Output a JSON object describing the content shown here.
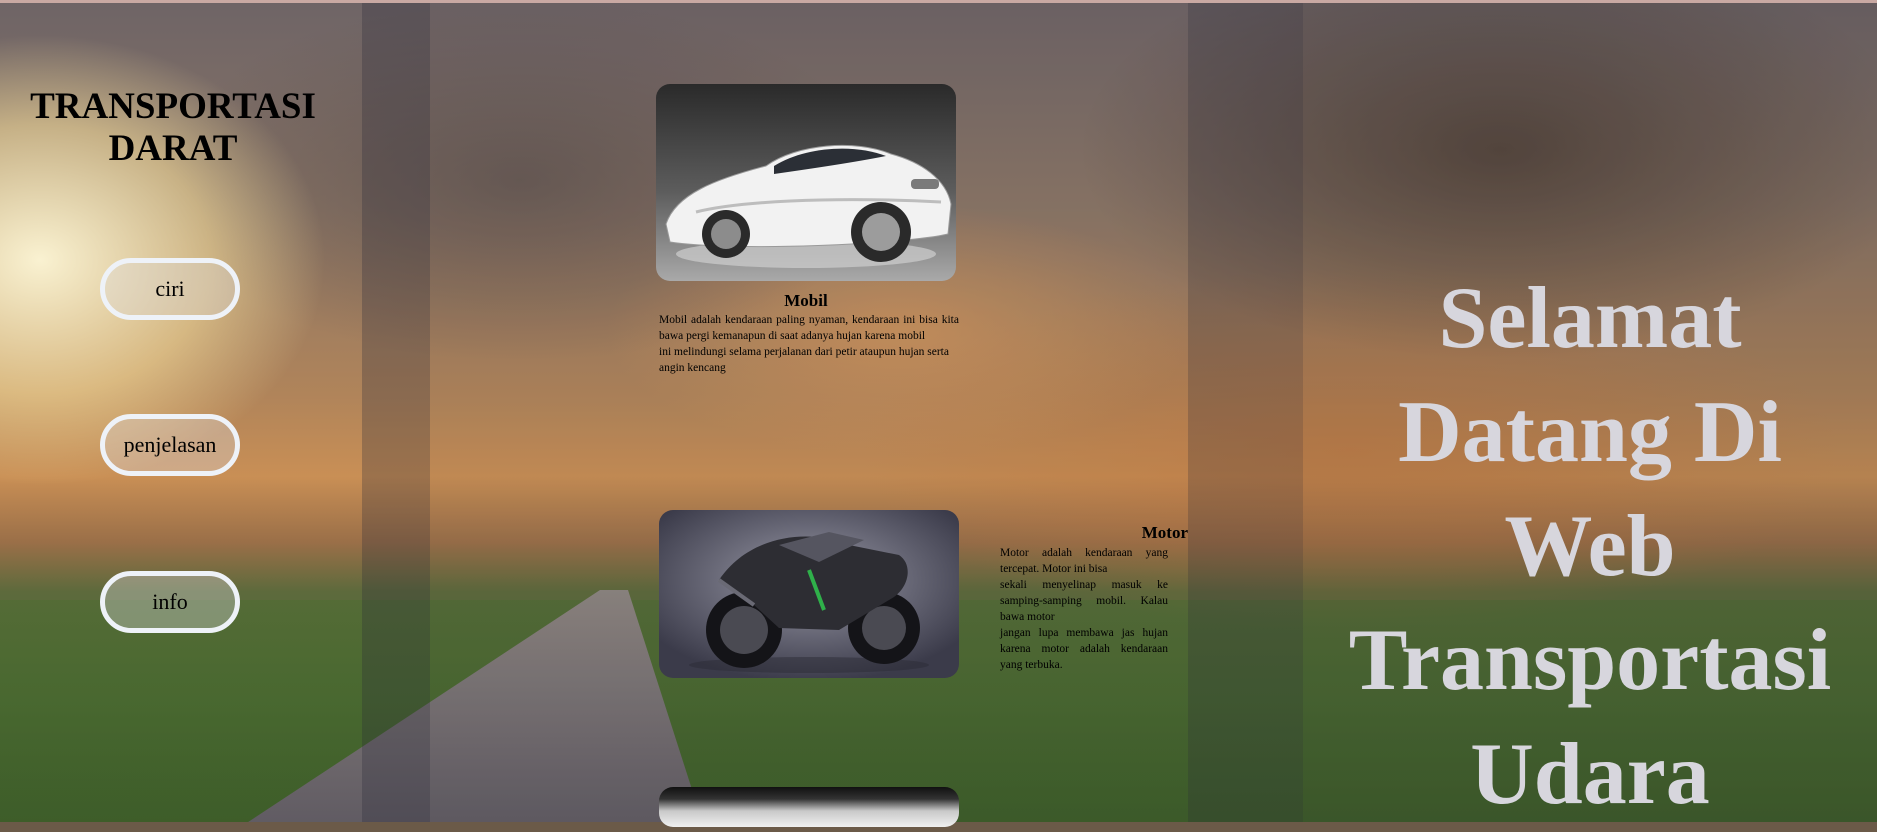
{
  "sidebar": {
    "brand_line1": "TRANSPORTASI",
    "brand_line2": "DARAT",
    "nav": [
      {
        "label": "ciri"
      },
      {
        "label": "penjelasan"
      },
      {
        "label": "info"
      }
    ]
  },
  "cards": {
    "mobil": {
      "title": "Mobil",
      "lines": [
        "Mobil adalah kendaraan paling nyaman, kendaraan ini bisa kita bawa pergi kemanapun di saat adanya hujan karena mobil",
        "ini melindungi selama perjalanan dari petir ataupun hujan serta",
        "angin kencang"
      ]
    },
    "motor": {
      "title": "Motor",
      "lines": [
        "Motor adalah kendaraan yang tercepat. Motor ini bisa",
        "sekali menyelinap masuk ke samping-samping mobil. Kalau bawa motor",
        "jangan lupa membawa jas hujan karena motor adalah kendaraan yang terbuka."
      ]
    }
  },
  "welcome": {
    "lines": [
      "Selamat",
      "Datang Di",
      "Web",
      "Transportasi",
      "Udara"
    ]
  }
}
